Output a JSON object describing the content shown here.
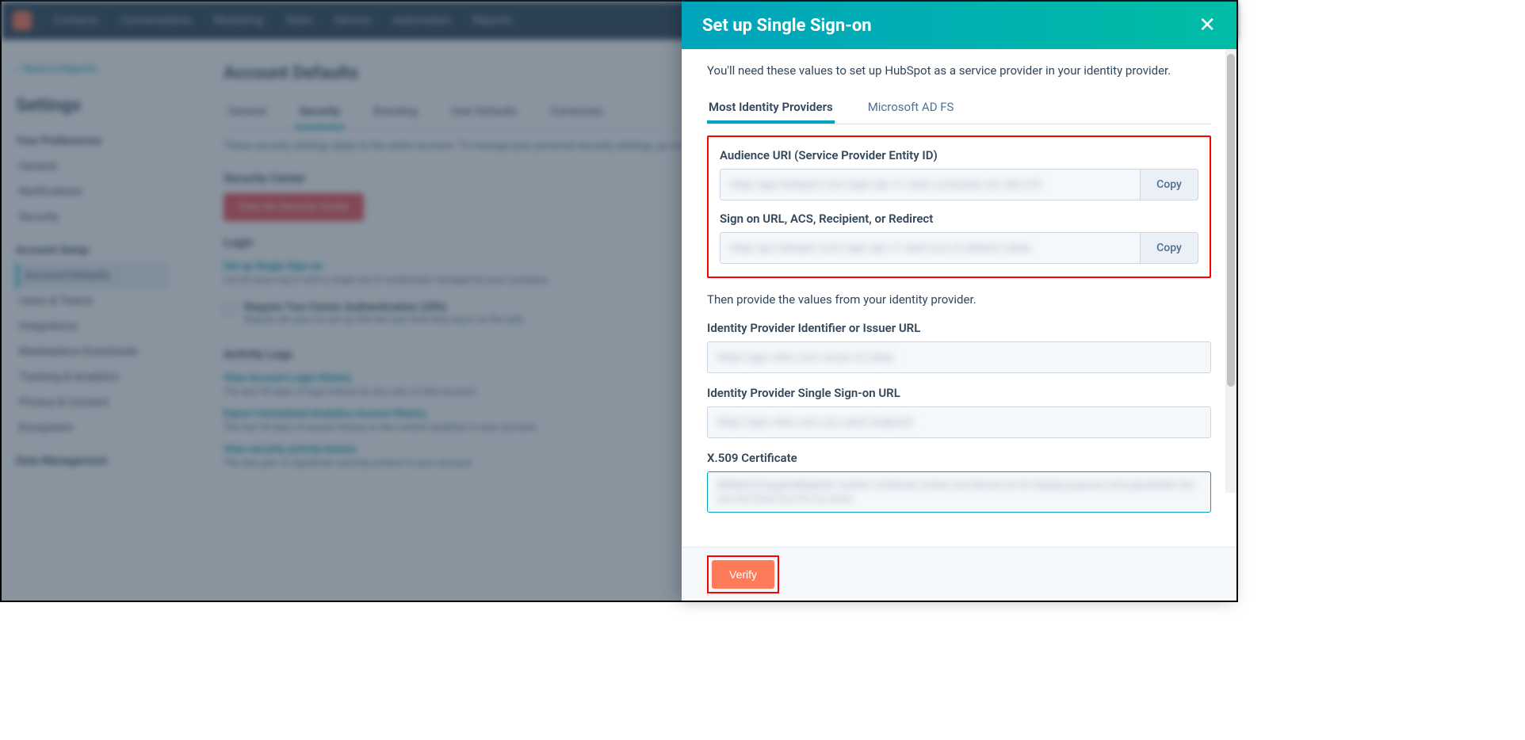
{
  "nav": {
    "items": [
      "Contacts",
      "Conversations",
      "Marketing",
      "Sales",
      "Service",
      "Automation",
      "Reports"
    ]
  },
  "sidebar": {
    "back": "Back to Reports",
    "title": "Settings",
    "pref_header": "Your Preferences",
    "pref_items": [
      "General",
      "Notifications",
      "Security"
    ],
    "acct_header": "Account Setup",
    "acct_items": [
      "Account Defaults",
      "Users & Teams",
      "Integrations",
      "Marketplace Downloads",
      "Tracking & Analytics",
      "Privacy & Consent",
      "Ecosystem"
    ],
    "data_header": "Data Management"
  },
  "main": {
    "title": "Account Defaults",
    "tabs": [
      "General",
      "Security",
      "Branding",
      "User Defaults",
      "Currencies"
    ],
    "tab_desc": "These security settings apply to the entire account. To manage your personal security settings, go to Profile & Preferences.",
    "sec_center": "Security Center",
    "sec_btn": "View the Security Center",
    "login_h": "Login",
    "sso_link": "Set up Single Sign-on",
    "sso_desc": "Let all users log in with a single set of credentials managed by your company.",
    "twofa_label": "Require Two-Factor Authentication (2FA)",
    "twofa_desc": "Require all users to set up 2FA the next time they log in on the web.",
    "activity_h": "Activity Logs",
    "l1": "View Account Login History",
    "l1d": "The last 90 days of login history by any user on this account.",
    "l2": "Export Centralized Analytics Access History",
    "l2d": "The last 90 days of access history to the content analytics in your account.",
    "l3": "View security activity history",
    "l3d": "The last year of significant security actions in your account."
  },
  "panel": {
    "title": "Set up Single Sign-on",
    "intro": "You'll need these values to set up HubSpot as a service provider in your identity provider.",
    "tabs": {
      "most": "Most Identity Providers",
      "ms": "Microsoft AD FS"
    },
    "audience_label": "Audience URI (Service Provider Entity ID)",
    "signon_label": "Sign on URL, ACS, Recipient, or Redirect",
    "copy": "Copy",
    "then": "Then provide the values from your identity provider.",
    "idp_id_label": "Identity Provider Identifier or Issuer URL",
    "idp_sso_label": "Identity Provider Single Sign-on URL",
    "cert_label": "X.509 Certificate",
    "verify": "Verify"
  }
}
